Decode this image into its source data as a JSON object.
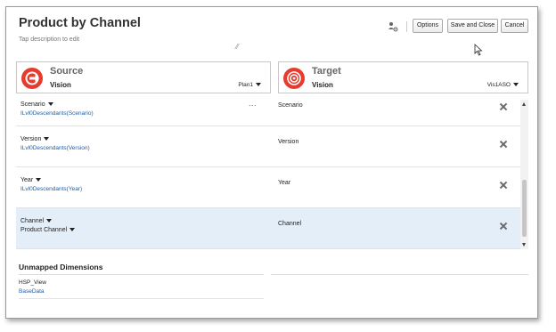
{
  "header": {
    "title": "Product by Channel",
    "description_placeholder": "Tap description to edit"
  },
  "toolbar": {
    "options_label": "Options",
    "save_close_label": "Save and Close",
    "cancel_label": "Cancel",
    "icon": "person-settings-icon"
  },
  "source": {
    "label": "Source",
    "app": "Vision",
    "cube": "Plan1",
    "icon": "source-arrow-icon",
    "icon_color": "#e53c2e"
  },
  "target": {
    "label": "Target",
    "app": "Vision",
    "cube": "Vis1ASO",
    "icon": "target-icon",
    "icon_color": "#e53c2e"
  },
  "mappings": [
    {
      "source_dim": "Scenario",
      "source_expr": "ILvl0Descendants(Scenario)",
      "target_dim": "Scenario"
    },
    {
      "source_dim": "Version",
      "source_expr": "ILvl0Descendants(Version)",
      "target_dim": "Version"
    },
    {
      "source_dim": "Year",
      "source_expr": "ILvl0Descendants(Year)",
      "target_dim": "Year"
    },
    {
      "source_dim": "Channel",
      "source_dim2": "Product Channel",
      "target_dim": "Channel"
    }
  ],
  "more_actions": "...",
  "unmapped": {
    "title": "Unmapped Dimensions",
    "items": [
      {
        "name": "HSP_View",
        "value": "BaseData"
      }
    ]
  },
  "colors": {
    "accent_red": "#e53c2e",
    "link_blue": "#1f5fa6",
    "selected_row": "#e4eef9"
  }
}
